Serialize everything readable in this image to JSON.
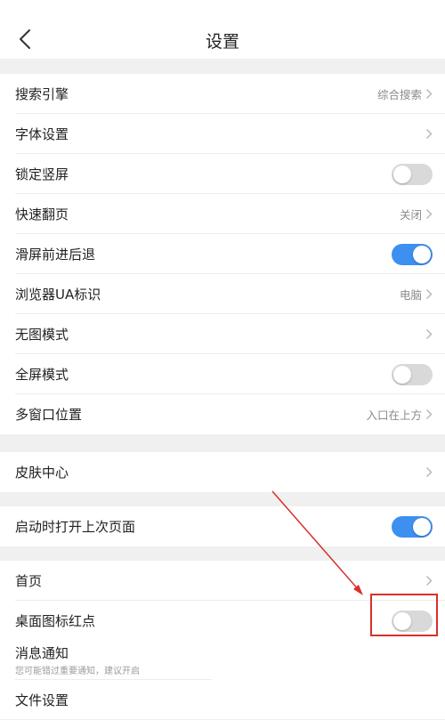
{
  "header": {
    "title": "设置"
  },
  "groups": [
    {
      "rows": [
        {
          "label": "搜索引擎",
          "value": "综合搜索"
        },
        {
          "label": "字体设置",
          "value": ""
        },
        {
          "label": "锁定竖屏",
          "toggle": "off"
        },
        {
          "label": "快速翻页",
          "value": "关闭"
        },
        {
          "label": "滑屏前进后退",
          "toggle": "on"
        },
        {
          "label": "浏览器UA标识",
          "value": "电脑"
        },
        {
          "label": "无图模式",
          "value": ""
        },
        {
          "label": "全屏模式",
          "toggle": "off"
        },
        {
          "label": "多窗口位置",
          "value": "入口在上方"
        }
      ]
    },
    {
      "rows": [
        {
          "label": "皮肤中心",
          "value": ""
        }
      ]
    },
    {
      "rows": [
        {
          "label": "启动时打开上次页面",
          "toggle": "on"
        }
      ]
    },
    {
      "rows": [
        {
          "label": "首页",
          "value": ""
        },
        {
          "label": "桌面图标红点",
          "toggle": "off"
        },
        {
          "label": "消息通知",
          "sublabel": "您可能错过重要通知，建议开启"
        },
        {
          "label": "文件设置"
        }
      ]
    }
  ],
  "colors": {
    "accent": "#3d8ff0",
    "annotation": "#d9302a"
  }
}
